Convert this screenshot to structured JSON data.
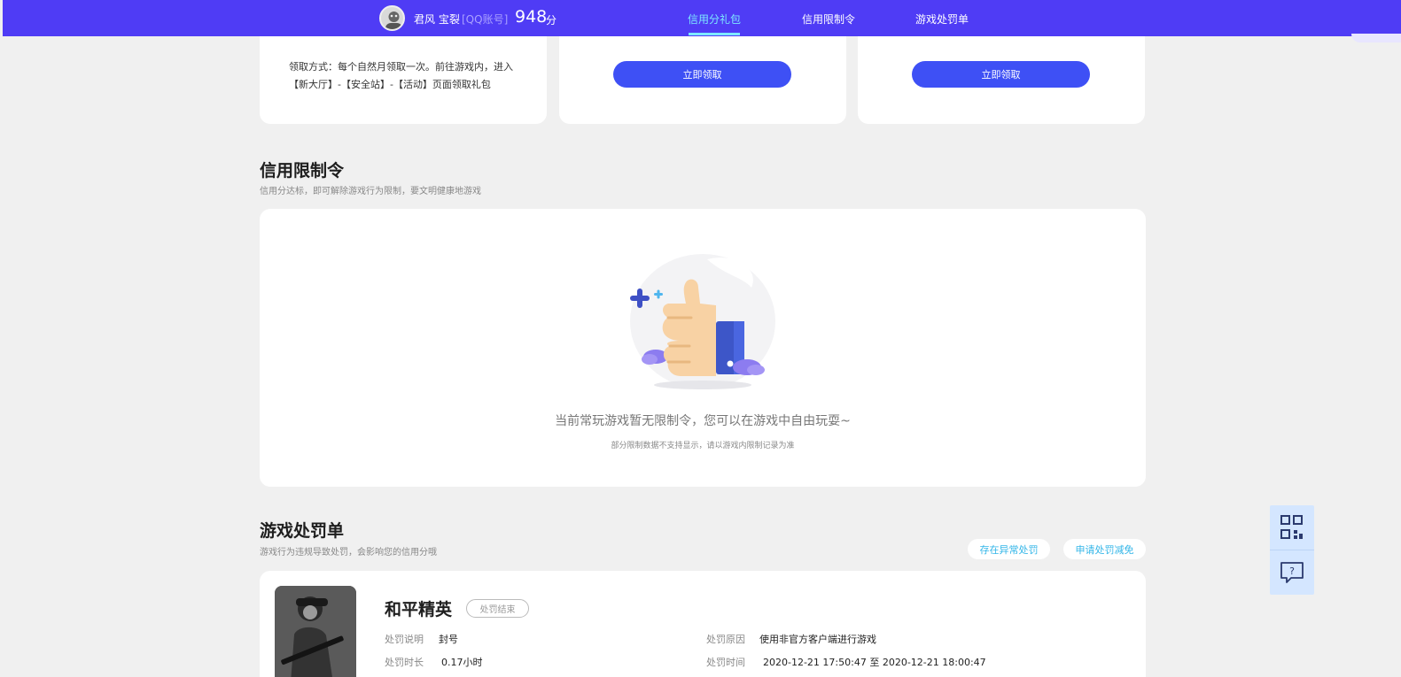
{
  "topbar": {
    "user_name": "君风 宝裂",
    "account_type": "[QQ账号]",
    "score": "948",
    "score_unit": "分",
    "nav": [
      {
        "label": "信用分礼包",
        "active": true
      },
      {
        "label": "信用限制令",
        "active": false
      },
      {
        "label": "游戏处罚单",
        "active": false
      }
    ]
  },
  "gift": {
    "description": "领取方式：每个自然月领取一次。前往游戏内，进入【新大厅】-【安全站】-【活动】页面领取礼包",
    "claim_button_1": "立即领取",
    "claim_button_2": "立即领取"
  },
  "restriction": {
    "title": "信用限制令",
    "subtitle": "信用分达标，即可解除游戏行为限制，要文明健康地游戏",
    "empty_main": "当前常玩游戏暂无限制令，您可以在游戏中自由玩耍~",
    "empty_sub": "部分限制数据不支持显示，请以游戏内限制记录为准"
  },
  "penalty": {
    "title": "游戏处罚单",
    "subtitle": "游戏行为违规导致处罚，会影响您的信用分哦",
    "abnormal_button": "存在异常处罚",
    "reduce_button": "申请处罚减免",
    "game_name": "和平精英",
    "status": "处罚结束",
    "desc_label": "处罚说明",
    "desc_value": "封号",
    "duration_label": "处罚时长",
    "duration_value": "0.17小时",
    "reason_label": "处罚原因",
    "reason_value": "使用非官方客户端进行游戏",
    "time_label": "处罚时间",
    "time_value": "2020-12-21 17:50:47 至 2020-12-21 18:00:47"
  },
  "colors": {
    "topbar": "#4f3cf5",
    "primary_button": "#3e50f5",
    "active_nav": "#7de8ff",
    "pill_text": "#33b6e8"
  },
  "icons": {
    "side_top": "qrcode-icon",
    "side_bottom": "feedback-icon",
    "empty": "thumbs-up-illustration"
  }
}
